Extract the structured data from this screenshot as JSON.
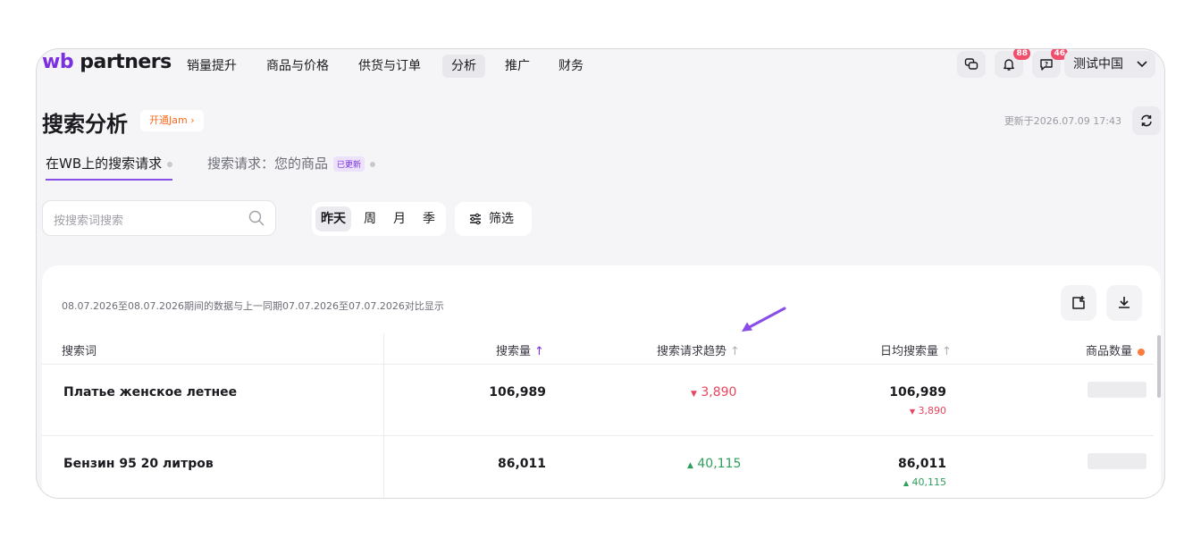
{
  "app": {
    "logo_prefix": "wb",
    "logo_suffix": " partners"
  },
  "nav": {
    "items": [
      "销量提升",
      "商品与价格",
      "供货与订单",
      "分析",
      "推广",
      "财务"
    ],
    "active_index": 3
  },
  "header": {
    "notifications_count": "88",
    "messages_count": "46",
    "user_name": "测试中国"
  },
  "page": {
    "title": "搜索分析",
    "jam_label": "开通Jam",
    "updated_text": "更新于2026.07.09 17:43"
  },
  "tabs": [
    {
      "label": "在WB上的搜索请求",
      "active": true
    },
    {
      "label": "搜索请求：您的商品",
      "badge": "已更新",
      "active": false
    }
  ],
  "filters": {
    "search_placeholder": "按搜索词搜索",
    "periods": [
      "昨天",
      "周",
      "月",
      "季"
    ],
    "selected_period": "昨天",
    "filter_label": "筛选"
  },
  "table": {
    "period_note": "08.07.2026至08.07.2026期间的数据与上一同期07.07.2026至07.07.2026对比显示",
    "columns": {
      "term": "搜索词",
      "volume": "搜索量",
      "trend": "搜索请求趋势",
      "daily": "日均搜索量",
      "products": "商品数量"
    },
    "rows": [
      {
        "term": "Платье женское летнее",
        "volume": "106,989",
        "trend": "3,890",
        "trend_dir": "down",
        "daily": "106,989",
        "daily_change": "3,890",
        "daily_dir": "down"
      },
      {
        "term": "Бензин 95 20 литров",
        "volume": "86,011",
        "trend": "40,115",
        "trend_dir": "up",
        "daily": "86,011",
        "daily_change": "40,115",
        "daily_dir": "up"
      }
    ]
  },
  "colors": {
    "accent": "#7b2fe0",
    "down": "#e8455e",
    "up": "#2e9e5b",
    "jam": "#ff6a1f"
  }
}
